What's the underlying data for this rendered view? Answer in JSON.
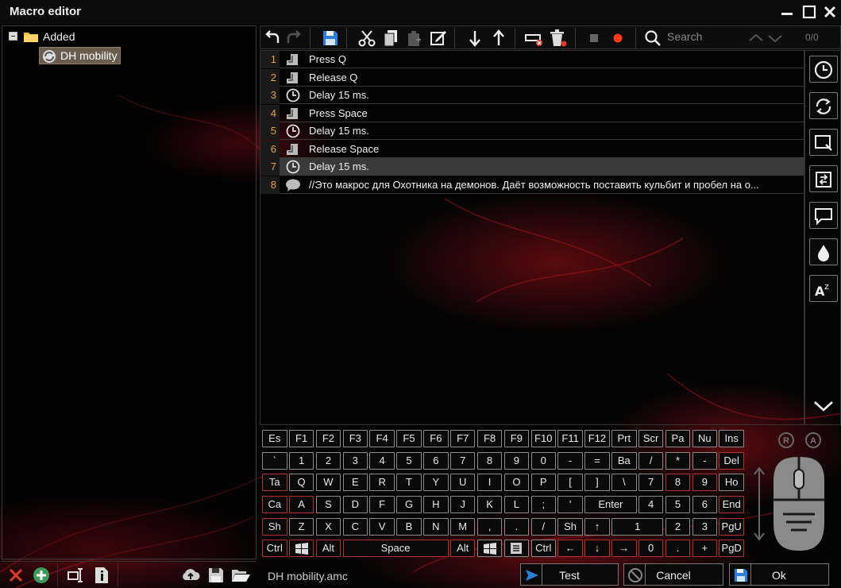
{
  "window": {
    "title": "Macro editor",
    "minimize": "—",
    "maximize": "☐",
    "close": "✕"
  },
  "tree": {
    "folder": {
      "label": "Added",
      "icon": "folder-icon"
    },
    "items": [
      {
        "label": "DH mobility",
        "icon": "macro-refresh-icon",
        "selected": true
      }
    ]
  },
  "toolbar": {
    "search_placeholder": "Search",
    "search_count": "0/0",
    "record_color": "#ff3a1a"
  },
  "steps": [
    {
      "num": "1",
      "icon": "key-icon",
      "text": "Press Q"
    },
    {
      "num": "2",
      "icon": "key-icon",
      "text": "Release Q"
    },
    {
      "num": "3",
      "icon": "clock-icon",
      "text": "Delay 15 ms."
    },
    {
      "num": "4",
      "icon": "key-icon",
      "text": "Press Space"
    },
    {
      "num": "5",
      "icon": "clock-icon",
      "text": "Delay 15 ms."
    },
    {
      "num": "6",
      "icon": "key-icon",
      "text": "Release Space"
    },
    {
      "num": "7",
      "icon": "clock-icon",
      "text": "Delay 15 ms.",
      "selected": true
    },
    {
      "num": "8",
      "icon": "comment-icon",
      "text": "//Это макрос для Охотника на демонов. Даёт возможность поставить кульбит и пробел на о..."
    }
  ],
  "keyboard": {
    "rows": [
      [
        "Es",
        "F1",
        "F2",
        "F3",
        "F4",
        "F5",
        "F6",
        "F7",
        "F8",
        "F9",
        "F10",
        "F11",
        "F12",
        "Prt",
        "Scr",
        "Pa",
        "Nu",
        "Ins"
      ],
      [
        "`",
        "1",
        "2",
        "3",
        "4",
        "5",
        "6",
        "7",
        "8",
        "9",
        "0",
        "-",
        "=",
        "Ba",
        "/",
        "*",
        "-",
        "Del"
      ],
      [
        "Ta",
        "Q",
        "W",
        "E",
        "R",
        "T",
        "Y",
        "U",
        "I",
        "O",
        "P",
        "[",
        "]",
        "\\",
        "7",
        "8",
        "9",
        "Ho"
      ],
      [
        "Ca",
        "A",
        "S",
        "D",
        "F",
        "G",
        "H",
        "J",
        "K",
        "L",
        ";",
        "'",
        "Enter",
        "4",
        "5",
        "6",
        "End"
      ],
      [
        "Sh",
        "Z",
        "X",
        "C",
        "V",
        "B",
        "N",
        "M",
        ",",
        ".",
        "/",
        "Sh",
        "↑",
        "1",
        "2",
        "3",
        "PgU"
      ],
      [
        "Ctrl",
        "win",
        "Alt",
        "Space",
        "Alt",
        "win",
        "menu",
        "Ctrl",
        "←",
        "↓",
        "→",
        "0",
        ".",
        "+",
        "PgD"
      ]
    ]
  },
  "mouse": {
    "badge_r": "R",
    "badge_a": "A"
  },
  "footer": {
    "filename": "DH mobility.amc",
    "test_label": "Test",
    "cancel_label": "Cancel",
    "ok_label": "Ok"
  }
}
